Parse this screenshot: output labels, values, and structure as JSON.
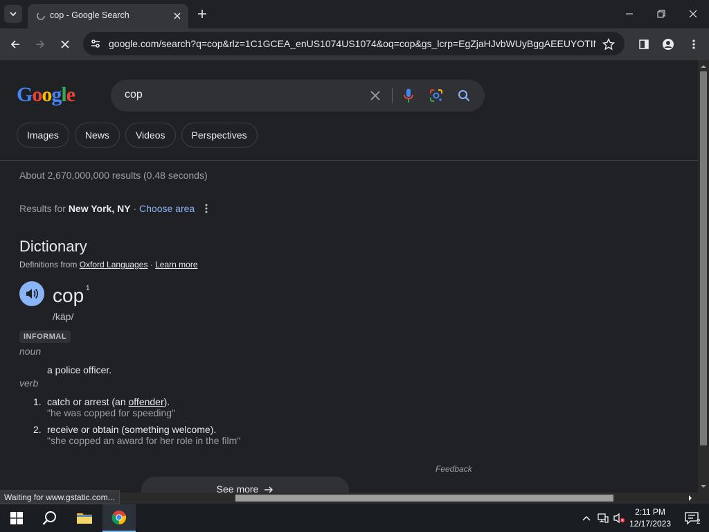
{
  "browser": {
    "tab_title": "cop - Google Search",
    "url": "google.com/search?q=cop&rlz=1C1GCEA_enUS1074US1074&oq=cop&gs_lcrp=EgZjaHJvbWUyBggAEEUYOTIM...",
    "status_text": "Waiting for www.gstatic.com..."
  },
  "google": {
    "logo_letters": [
      "G",
      "o",
      "o",
      "g",
      "l",
      "e"
    ],
    "logo_colors": [
      "#4285f4",
      "#ea4335",
      "#fbbc05",
      "#4285f4",
      "#34a853",
      "#ea4335"
    ],
    "query": "cop",
    "chips": [
      "Images",
      "News",
      "Videos",
      "Perspectives"
    ],
    "result_stats": "About 2,670,000,000 results (0.48 seconds)",
    "location": {
      "prefix": "Results for ",
      "place": "New York, NY",
      "sep": " · ",
      "link": "Choose area"
    }
  },
  "dictionary": {
    "title": "Dictionary",
    "source_prefix": "Definitions from ",
    "source_name": "Oxford Languages",
    "source_sep": " · ",
    "learn_more": "Learn more",
    "word": "cop",
    "sup": "1",
    "phonetic": "/käp/",
    "label": "INFORMAL",
    "noun": {
      "pos": "noun",
      "definition": "a police officer."
    },
    "verb": {
      "pos": "verb",
      "defs": [
        {
          "num": "1.",
          "pre": "catch or arrest (an ",
          "link": "offender",
          "post": ").",
          "example": "\"he was copped for speeding\""
        },
        {
          "num": "2.",
          "pre": "receive or obtain (something welcome).",
          "link": "",
          "post": "",
          "example": "\"she copped an award for her role in the film\""
        }
      ]
    },
    "feedback": "Feedback",
    "see_more": "See more"
  },
  "taskbar": {
    "time": "2:11 PM",
    "date": "12/17/2023",
    "notification_count": "2"
  }
}
